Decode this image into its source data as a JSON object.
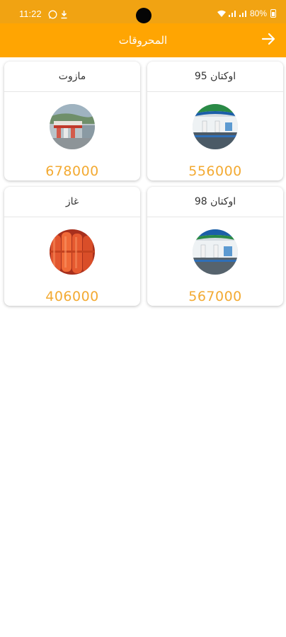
{
  "status_bar": {
    "time": "11:22",
    "battery": "80%"
  },
  "app_bar": {
    "title": "المحروقات",
    "back_icon": "arrow-right-icon"
  },
  "fuels": [
    {
      "name": "مازوت",
      "price": "678000",
      "image": "fuel-station-photo"
    },
    {
      "name": "اوكتان 95",
      "price": "556000",
      "image": "gas-station-photo"
    },
    {
      "name": "غاز",
      "price": "406000",
      "image": "gas-cylinders-photo"
    },
    {
      "name": "اوكتان 98",
      "price": "567000",
      "image": "gas-station-photo"
    }
  ],
  "colors": {
    "app_bar": "#ffa502",
    "status_bar": "#f1a312",
    "price": "#f3aa32"
  }
}
